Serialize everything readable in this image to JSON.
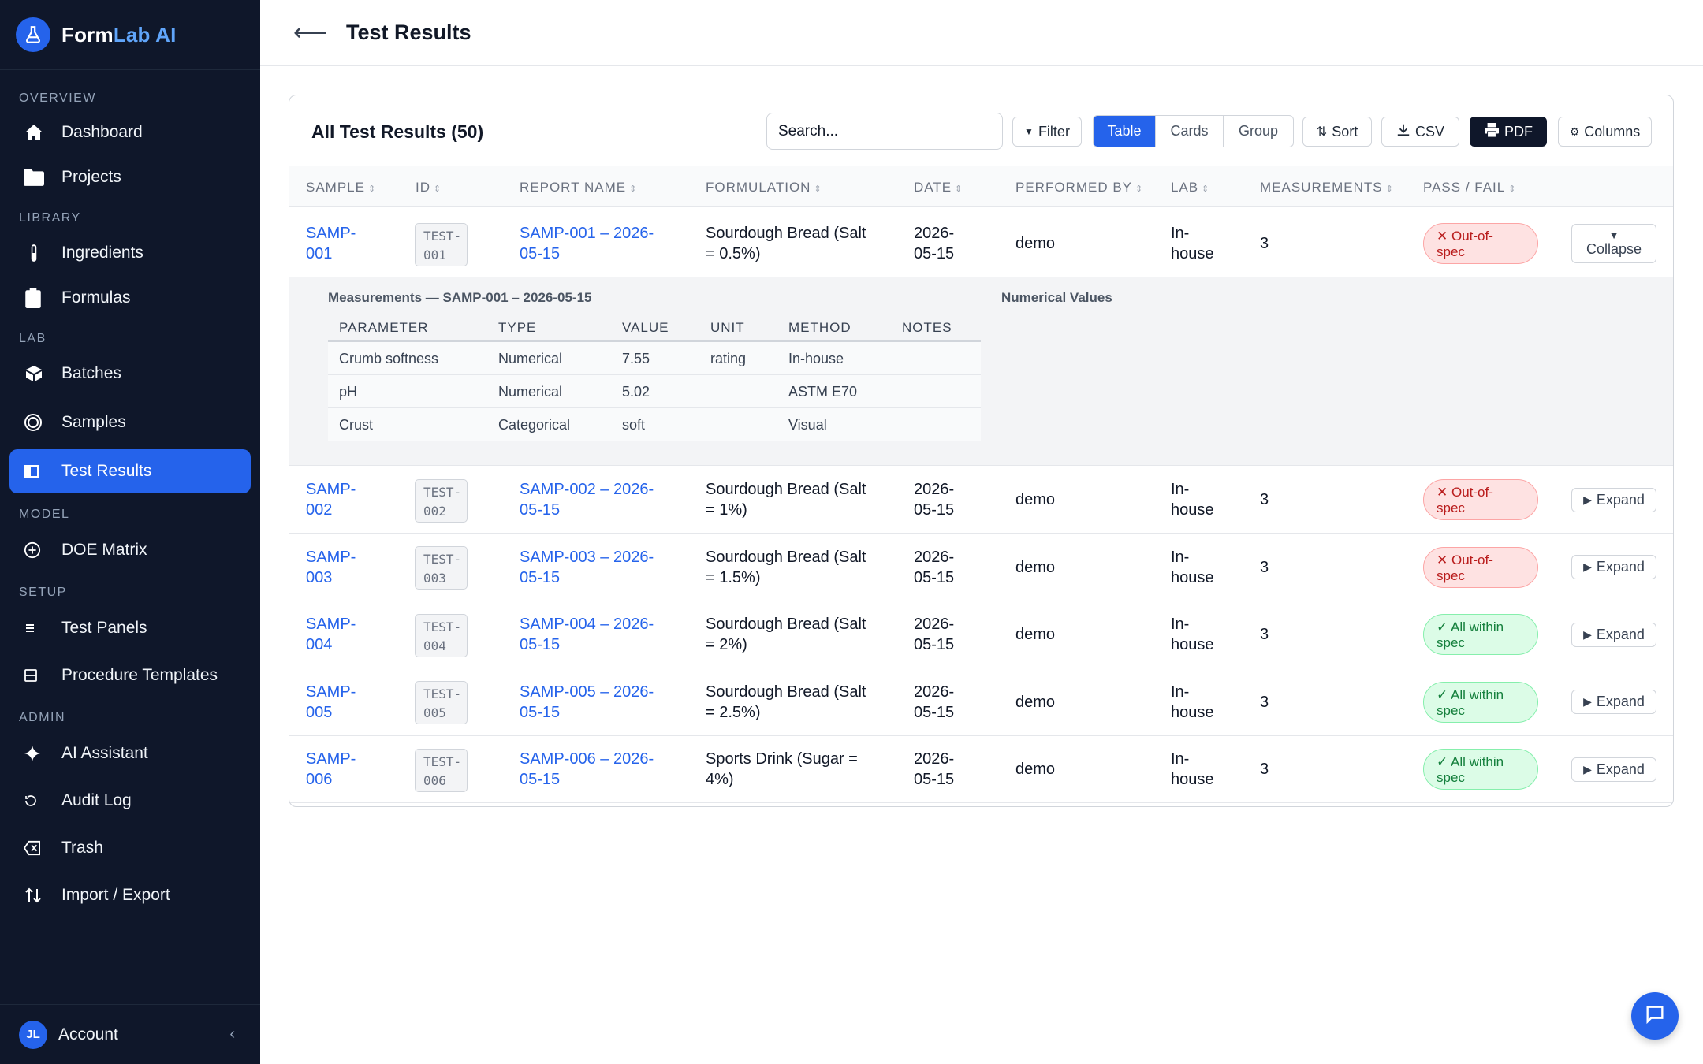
{
  "app": {
    "brand_main": "Form",
    "brand_accent": "Lab AI"
  },
  "sidebar": {
    "sections": [
      "OVERVIEW",
      "LIBRARY",
      "LAB",
      "MODEL",
      "SETUP",
      "ADMIN"
    ],
    "items": [
      {
        "label": "Dashboard",
        "icon": "home-icon"
      },
      {
        "label": "Projects",
        "icon": "folder-icon"
      },
      {
        "label": "Ingredients",
        "icon": "test-tube-icon"
      },
      {
        "label": "Formulas",
        "icon": "clipboard-icon"
      },
      {
        "label": "Batches",
        "icon": "box-icon"
      },
      {
        "label": "Samples",
        "icon": "circle-icon"
      },
      {
        "label": "Test Results",
        "icon": "panel-icon",
        "active": true
      },
      {
        "label": "DOE Matrix",
        "icon": "plus-circle-icon"
      },
      {
        "label": "Test Panels",
        "icon": "list-icon"
      },
      {
        "label": "Procedure Templates",
        "icon": "template-icon"
      },
      {
        "label": "AI Assistant",
        "icon": "sparkle-icon"
      },
      {
        "label": "Audit Log",
        "icon": "history-icon"
      },
      {
        "label": "Trash",
        "icon": "trash-icon"
      },
      {
        "label": "Import / Export",
        "icon": "arrows-icon"
      }
    ],
    "account": {
      "initials": "JL",
      "label": "Account"
    }
  },
  "header": {
    "title": "Test Results"
  },
  "toolbar": {
    "card_title": "All Test Results (50)",
    "search_placeholder": "Search...",
    "filter_label": "Filter",
    "views": [
      "Table",
      "Cards",
      "Group"
    ],
    "active_view": "Table",
    "sort_label": "Sort",
    "csv_label": "CSV",
    "pdf_label": "PDF",
    "columns_label": "Columns"
  },
  "table": {
    "columns": [
      "SAMPLE",
      "ID",
      "REPORT NAME",
      "FORMULATION",
      "DATE",
      "PERFORMED BY",
      "LAB",
      "MEASUREMENTS",
      "PASS / FAIL"
    ],
    "rows": [
      {
        "sample_1": "SAMP-",
        "sample_2": "001",
        "id_1": "TEST-",
        "id_2": "001",
        "report_1": "SAMP-001 – 2026-",
        "report_2": "05-15",
        "formulation_1": "Sourdough Bread (Salt",
        "formulation_2": "= 0.5%)",
        "date_1": "2026-",
        "date_2": "05-15",
        "performed_by": "demo",
        "lab_1": "In-",
        "lab_2": "house",
        "measurements": "3",
        "status_1": "Out-of-",
        "status_2": "spec",
        "action": "Collapse"
      },
      {
        "sample_1": "SAMP-",
        "sample_2": "002",
        "id_1": "TEST-",
        "id_2": "002",
        "report_1": "SAMP-002 – 2026-",
        "report_2": "05-15",
        "formulation_1": "Sourdough Bread (Salt",
        "formulation_2": "= 1%)",
        "date_1": "2026-",
        "date_2": "05-15",
        "performed_by": "demo",
        "lab_1": "In-",
        "lab_2": "house",
        "measurements": "3",
        "status_1": "Out-of-",
        "status_2": "spec",
        "action": "Expand"
      },
      {
        "sample_1": "SAMP-",
        "sample_2": "003",
        "id_1": "TEST-",
        "id_2": "003",
        "report_1": "SAMP-003 – 2026-",
        "report_2": "05-15",
        "formulation_1": "Sourdough Bread (Salt",
        "formulation_2": "= 1.5%)",
        "date_1": "2026-",
        "date_2": "05-15",
        "performed_by": "demo",
        "lab_1": "In-",
        "lab_2": "house",
        "measurements": "3",
        "status_1": "Out-of-",
        "status_2": "spec",
        "action": "Expand"
      },
      {
        "sample_1": "SAMP-",
        "sample_2": "004",
        "id_1": "TEST-",
        "id_2": "004",
        "report_1": "SAMP-004 – 2026-",
        "report_2": "05-15",
        "formulation_1": "Sourdough Bread (Salt",
        "formulation_2": "= 2%)",
        "date_1": "2026-",
        "date_2": "05-15",
        "performed_by": "demo",
        "lab_1": "In-",
        "lab_2": "house",
        "measurements": "3",
        "status_1": "All within",
        "status_2": "spec",
        "action": "Expand"
      },
      {
        "sample_1": "SAMP-",
        "sample_2": "005",
        "id_1": "TEST-",
        "id_2": "005",
        "report_1": "SAMP-005 – 2026-",
        "report_2": "05-15",
        "formulation_1": "Sourdough Bread (Salt",
        "formulation_2": "= 2.5%)",
        "date_1": "2026-",
        "date_2": "05-15",
        "performed_by": "demo",
        "lab_1": "In-",
        "lab_2": "house",
        "measurements": "3",
        "status_1": "All within",
        "status_2": "spec",
        "action": "Expand"
      },
      {
        "sample_1": "SAMP-",
        "sample_2": "006",
        "id_1": "TEST-",
        "id_2": "006",
        "report_1": "SAMP-006 – 2026-",
        "report_2": "05-15",
        "formulation_1": "Sports Drink (Sugar =",
        "formulation_2": "4%)",
        "date_1": "2026-",
        "date_2": "05-15",
        "performed_by": "demo",
        "lab_1": "In-",
        "lab_2": "house",
        "measurements": "3",
        "status_1": "All within",
        "status_2": "spec",
        "action": "Expand"
      }
    ]
  },
  "detail": {
    "title": "Measurements — SAMP-001 – 2026-05-15",
    "side_title": "Numerical Values",
    "columns": [
      "PARAMETER",
      "TYPE",
      "VALUE",
      "UNIT",
      "METHOD",
      "NOTES"
    ],
    "rows": [
      [
        "Crumb softness",
        "Numerical",
        "7.55",
        "rating",
        "In-house",
        ""
      ],
      [
        "pH",
        "Numerical",
        "5.02",
        "",
        "ASTM E70",
        ""
      ],
      [
        "Crust",
        "Categorical",
        "soft",
        "",
        "Visual",
        ""
      ]
    ]
  },
  "colors": {
    "sidebar_bg": "#0f172a",
    "accent": "#2563eb",
    "fail": "#b91c1c",
    "pass": "#15803d"
  }
}
